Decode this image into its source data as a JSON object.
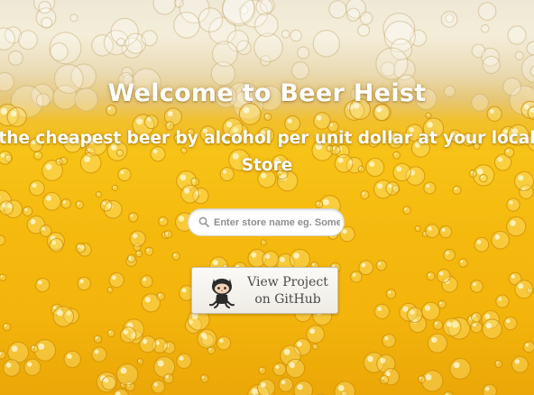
{
  "hero": {
    "title": "Welcome to Beer Heist",
    "tagline_line1": "the cheapest beer by alcohol per unit dollar at your local",
    "tagline_line2": "Store"
  },
  "search": {
    "placeholder": "Enter store name eg. Some",
    "value": "",
    "icon": "search-icon"
  },
  "github_button": {
    "line1": "View Project",
    "line2": "on GitHub",
    "icon": "octocat-icon"
  },
  "colors": {
    "beer": "#f5b90e",
    "foam": "#f1ead8",
    "text": "#ffffff"
  }
}
